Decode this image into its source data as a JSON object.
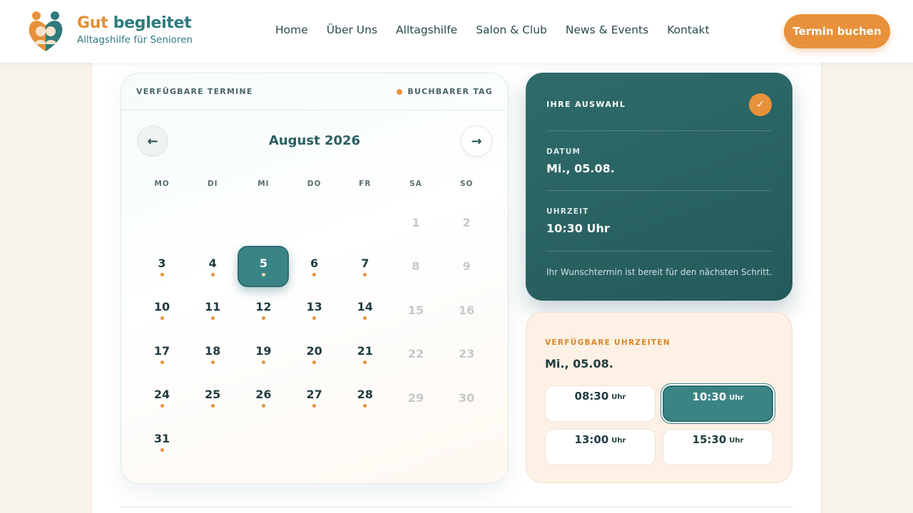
{
  "brand": {
    "title_part1": "Gut",
    "title_part2": "begleitet",
    "subtitle": "Alltagshilfe für Senioren"
  },
  "nav": [
    "Home",
    "Über Uns",
    "Alltagshilfe",
    "Salon & Club",
    "News & Events",
    "Kontakt"
  ],
  "cta": "Termin buchen",
  "calendar": {
    "header": "VERFÜGBARE TERMINE",
    "legend": "BUCHBARER TAG",
    "month": "August 2026",
    "prev_icon": "←",
    "next_icon": "→",
    "weekdays": [
      "MO",
      "DI",
      "MI",
      "DO",
      "FR",
      "SA",
      "SO"
    ],
    "days": [
      {
        "n": "1",
        "available": false
      },
      {
        "n": "2",
        "available": false
      },
      {
        "n": "3",
        "available": true
      },
      {
        "n": "4",
        "available": true
      },
      {
        "n": "5",
        "available": true,
        "selected": true
      },
      {
        "n": "6",
        "available": true
      },
      {
        "n": "7",
        "available": true
      },
      {
        "n": "8",
        "available": false
      },
      {
        "n": "9",
        "available": false
      },
      {
        "n": "10",
        "available": true
      },
      {
        "n": "11",
        "available": true
      },
      {
        "n": "12",
        "available": true
      },
      {
        "n": "13",
        "available": true
      },
      {
        "n": "14",
        "available": true
      },
      {
        "n": "15",
        "available": false
      },
      {
        "n": "16",
        "available": false
      },
      {
        "n": "17",
        "available": true
      },
      {
        "n": "18",
        "available": true
      },
      {
        "n": "19",
        "available": true
      },
      {
        "n": "20",
        "available": true
      },
      {
        "n": "21",
        "available": true
      },
      {
        "n": "22",
        "available": false
      },
      {
        "n": "23",
        "available": false
      },
      {
        "n": "24",
        "available": true
      },
      {
        "n": "25",
        "available": true
      },
      {
        "n": "26",
        "available": true
      },
      {
        "n": "27",
        "available": true
      },
      {
        "n": "28",
        "available": true
      },
      {
        "n": "29",
        "available": false
      },
      {
        "n": "30",
        "available": false
      },
      {
        "n": "31",
        "available": true
      }
    ]
  },
  "selection": {
    "title": "IHRE AUSWAHL",
    "check_icon": "✓",
    "date_label": "DATUM",
    "date_value": "Mi., 05.08.",
    "time_label": "UHRZEIT",
    "time_value": "10:30 Uhr",
    "note": "Ihr Wunschtermin ist bereit für den nächsten Schritt."
  },
  "times": {
    "title": "VERFÜGBARE UHRZEITEN",
    "date": "Mi., 05.08.",
    "unit": "Uhr",
    "slots": [
      {
        "time": "08:30",
        "active": false
      },
      {
        "time": "10:30",
        "active": true
      },
      {
        "time": "13:00",
        "active": false
      },
      {
        "time": "15:30",
        "active": false
      }
    ]
  },
  "colors": {
    "accent": "#e8913a",
    "teal": "#2e7a7c",
    "teal_dark": "#245a5b"
  }
}
